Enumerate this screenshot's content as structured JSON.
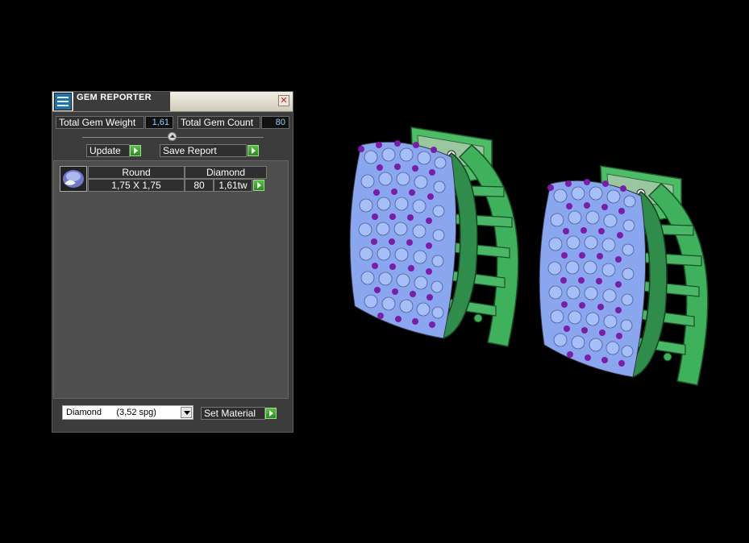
{
  "window": {
    "title": "GEM REPORTER",
    "close_glyph": "✕"
  },
  "stats": {
    "total_weight_label": "Total Gem Weight",
    "total_weight_value": "1,61",
    "total_count_label": "Total Gem Count",
    "total_count_value": "80"
  },
  "buttons": {
    "update": "Update",
    "save_report": "Save Report",
    "set_material": "Set Material"
  },
  "gem_row": {
    "shape": "Round",
    "material": "Diamond",
    "size": "1,75 X 1,75",
    "count": "80",
    "weight": "1,61tw"
  },
  "material_select": {
    "value": "Diamond      (3,52 spg)"
  },
  "icons": {
    "app": "gem-reporter-app-icon",
    "close": "close-icon",
    "collapse": "collapse-arrow-icon",
    "go": "green-arrow-icon",
    "gem": "round-gem-icon",
    "dropdown": "dropdown-arrow-icon"
  },
  "colors": {
    "background": "#000000",
    "panel": "#3c3c3c",
    "earring_band": "#3fb05c",
    "gem_fill": "#88a8f0",
    "prong": "#7a1ea8"
  }
}
